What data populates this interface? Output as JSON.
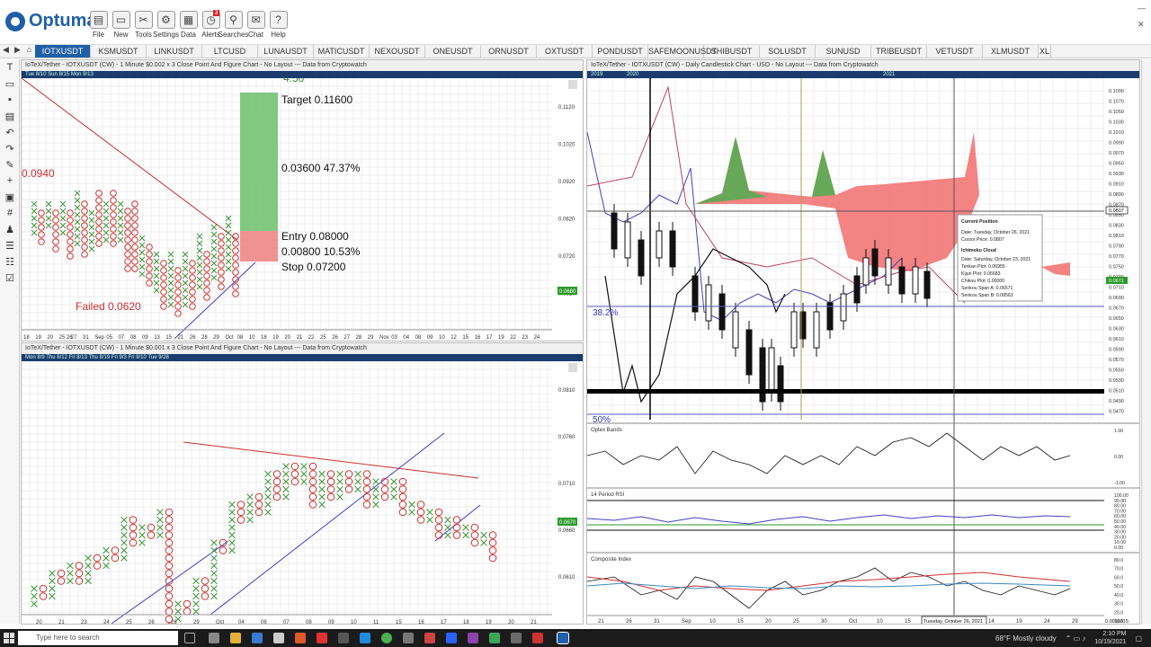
{
  "app": {
    "name": "Optuma"
  },
  "toolbar": [
    {
      "label": "File",
      "icon": "folder-icon"
    },
    {
      "label": "New",
      "icon": "new-file-icon"
    },
    {
      "label": "Tools",
      "icon": "tools-icon"
    },
    {
      "label": "Settings",
      "icon": "gear-icon"
    },
    {
      "label": "Data",
      "icon": "data-icon"
    },
    {
      "label": "Alerts",
      "icon": "alarm-icon",
      "badge": "3"
    },
    {
      "label": "Searches",
      "icon": "search-icon"
    },
    {
      "label": "Chat",
      "icon": "chat-icon"
    },
    {
      "label": "Help",
      "icon": "help-icon"
    }
  ],
  "symbol_tabs": [
    "IOTXUSDT",
    "KSMUSDT",
    "LINKUSDT",
    "LTCUSD",
    "LUNAUSDT",
    "MATICUSDT",
    "NEXOUSDT",
    "ONEUSDT",
    "ORNUSDT",
    "OXTUSDT",
    "PONDUSDT",
    "SAFEMOONUSDT",
    "SHIBUSDT",
    "SOLUSDT",
    "SUNUSD",
    "TRIBEUSDT",
    "VETUSDT",
    "XLMUSDT",
    "XL"
  ],
  "panel_top_left": {
    "title": "IoTeX/Tether - IOTXUSDT (CW) - 1 Minute $0.002 x 3 Close Point And Figure Chart - No Layout --- Data from Cryptowatch",
    "date_strip": "Tue 8/10      Sun 8/15 Mon 9/13",
    "price_labels": [
      "0.1120",
      "0.1020",
      "0.0920",
      "0.0820",
      "0.0720",
      "0.0620"
    ],
    "current_price": "0.0680",
    "annotations": {
      "top_value": "4.50",
      "target": "Target  0.11600",
      "gain": "0.03600  47.37%",
      "entry": "Entry  0.08000",
      "risk": "0.00800  10.53%",
      "stop": "Stop  0.07200",
      "high": "0.0940",
      "failed": "Failed 0.0620"
    },
    "x_labels": [
      "18",
      "19",
      "20",
      "25 26",
      "27",
      "31",
      "Sep",
      "05",
      "07",
      "08",
      "09",
      "13",
      "15",
      "21",
      "26",
      "28",
      "29",
      "Oct",
      "08",
      "10",
      "18",
      "19",
      "20",
      "21",
      "22",
      "25",
      "26",
      "27",
      "28",
      "29",
      "Nov",
      "03",
      "04",
      "08",
      "09",
      "10",
      "12",
      "15",
      "16",
      "17",
      "19",
      "22",
      "23",
      "24"
    ]
  },
  "panel_bottom_left": {
    "title": "IoTeX/Tether - IOTXUSDT (CW) - 1 Minute $0.001 x 3 Close Point And Figure Chart - No Layout --- Data from Cryptowatch",
    "date_strip": "Mon 8/9        Thu 8/12        Fri 8/13  Thu 8/19  Fri 9/3  Fri 9/10 Tue 9/28",
    "price_labels": [
      "0.0810",
      "0.0760",
      "0.0710",
      "0.0660",
      "0.0610"
    ],
    "current_price": "0.0670",
    "x_labels": [
      "20",
      "21",
      "23",
      "24",
      "25",
      "26",
      "28",
      "29",
      "Oct",
      "04",
      "06",
      "07",
      "08",
      "09",
      "10",
      "11",
      "15",
      "16",
      "17",
      "18",
      "19",
      "20",
      "21"
    ]
  },
  "panel_right": {
    "title": "IoTeX/Tether - IOTXUSDT (CW) - Daily Candlestick Chart - USD - No Layout --- Data from Cryptowatch",
    "year_strip": [
      "2019",
      "2020",
      "2021"
    ],
    "price_labels": [
      "0.1090",
      "0.1070",
      "0.1050",
      "0.1030",
      "0.1010",
      "0.0990",
      "0.0970",
      "0.0950",
      "0.0930",
      "0.0910",
      "0.0890",
      "0.0870",
      "0.0850",
      "0.0830",
      "0.0810",
      "0.0790",
      "0.0770",
      "0.0750",
      "0.0730",
      "0.0710",
      "0.0690",
      "0.0670",
      "0.0650",
      "0.0630",
      "0.0610",
      "0.0590",
      "0.0570",
      "0.0550",
      "0.0530",
      "0.0510",
      "0.0490",
      "0.0470"
    ],
    "crosshair_price": "0.0807",
    "current_price": "0.0671",
    "fib_labels": [
      "38.2%",
      "50%"
    ],
    "tooltip": {
      "title": "Current Position",
      "date": "Date: Tuesday, October 26, 2021",
      "cursor": "Cursor Price: 0.0807",
      "section": "Ichimoku Cloud",
      "date2": "Date: Saturday, October 23, 2021",
      "tenkan": "Tenkan Plot: 0.06955",
      "kijun": "Kijun Plot: 0.06683",
      "chikou": "Chikou Plot: 0.00000",
      "spanA": "Senkou Span A: 0.06571",
      "spanB": "Senkou Span B: 0.08563"
    },
    "ind1": {
      "name": "Optex Bands",
      "labels": [
        "1.00",
        "0.00",
        "-1.00"
      ]
    },
    "ind2": {
      "name": "14 Period RSI",
      "labels": [
        "100.00",
        "90.00",
        "80.00",
        "70.00",
        "60.00",
        "50.00",
        "40.00",
        "30.00",
        "20.00",
        "10.00",
        "0.00"
      ]
    },
    "ind3": {
      "name": "Composite Index",
      "labels": [
        "80.0",
        "70.0",
        "60.0",
        "50.0",
        "40.0",
        "30.0",
        "20.0",
        "10.0"
      ]
    },
    "x_labels": [
      "21",
      "26",
      "31",
      "Sep",
      "10",
      "15",
      "20",
      "25",
      "30",
      "Oct",
      "10",
      "15",
      "Nov",
      "09",
      "14",
      "19",
      "24",
      "29"
    ],
    "cursor_date": "Tuesday, October 26, 2021",
    "x_axis_readout": "0.0010315"
  },
  "taskbar": {
    "search_placeholder": "Type here to search",
    "weather": "68°F  Mostly cloudy",
    "time": "2:10 PM",
    "date": "10/19/2021"
  }
}
